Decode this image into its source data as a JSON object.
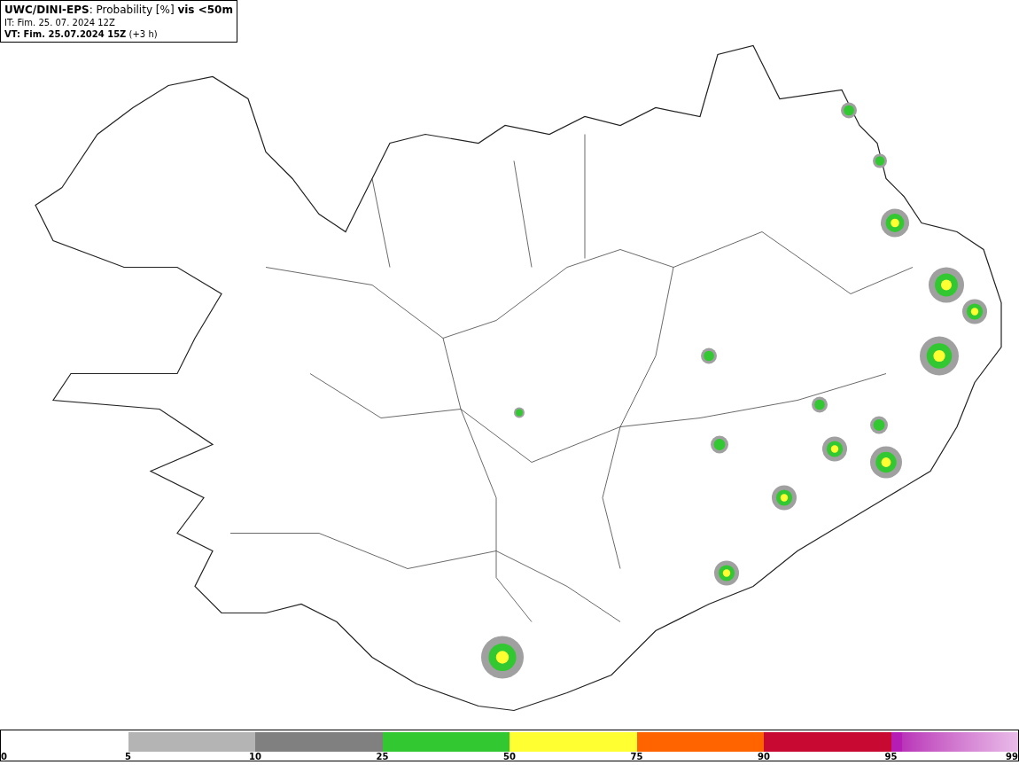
{
  "header": {
    "title": "**UWC/DINI-EPS**: Probability [%] **vis <50m**",
    "initial_time": "IT: Fim. 25. 07. 2024 12Z",
    "valid_time": "**VT: Fim. 25.07.2024 15Z** (+3 h)"
  },
  "legend": {
    "labels": [
      "0",
      "5",
      "10",
      "25",
      "50",
      "75",
      "90",
      "95",
      "99"
    ],
    "segments": [
      {
        "kind": "solid",
        "color": "#b4b4b4"
      },
      {
        "kind": "solid",
        "color": "#808080"
      },
      {
        "kind": "solid",
        "color": "#32c832"
      },
      {
        "kind": "solid",
        "color": "#ffff32"
      },
      {
        "kind": "solid",
        "color": "#ff6400"
      },
      {
        "kind": "solid",
        "color": "#c80a32"
      },
      {
        "kind": "gradient",
        "color": "#b41eb4"
      }
    ]
  }
}
